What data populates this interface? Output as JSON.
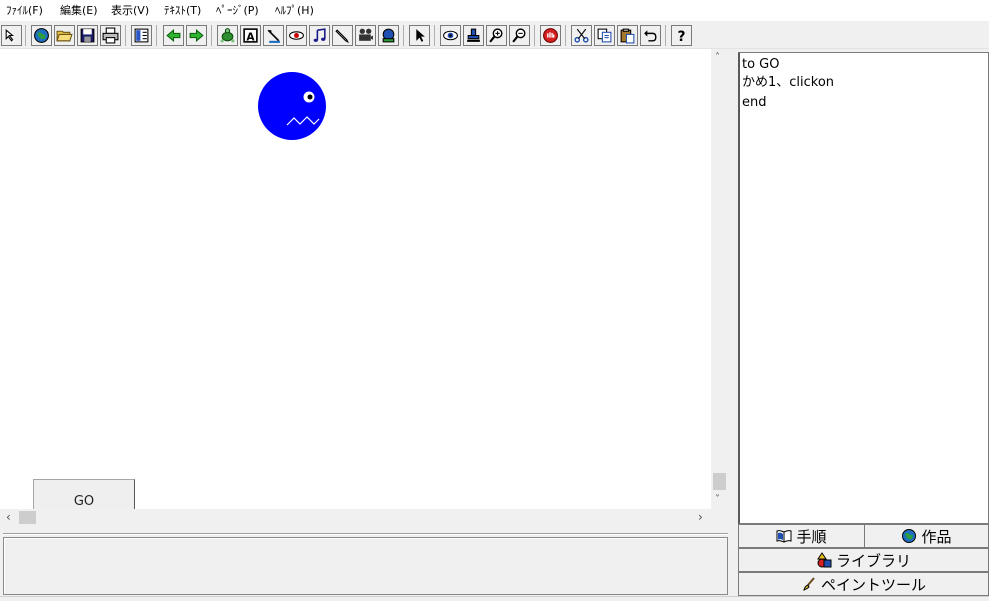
{
  "menu": {
    "file": "ﾌｧｲﾙ(F)",
    "edit": "編集(E)",
    "view": "表示(V)",
    "text": "ﾃｷｽﾄ(T)",
    "page": "ﾍﾟｰｼﾞ(P)",
    "help": "ﾍﾙﾌﾟ(H)"
  },
  "toolbar": {
    "icons": [
      "pointer-arrow-icon",
      "globe-icon",
      "open-folder-icon",
      "save-icon",
      "print-icon",
      "layout-icon",
      "back-arrow-icon",
      "forward-arrow-icon",
      "turtle-icon",
      "text-box-icon",
      "eraser-icon",
      "eye-stamp-icon",
      "music-note-icon",
      "pencil-icon",
      "camera-icon",
      "screen-icon",
      "select-arrow-icon",
      "eye-icon",
      "stamp-icon",
      "zoom-in-icon",
      "zoom-out-icon",
      "stop-icon",
      "cut-icon",
      "copy-icon",
      "paste-icon",
      "undo-icon",
      "help-icon"
    ]
  },
  "canvas": {
    "go_button_label": "GO",
    "turtle_color": "#0000ff"
  },
  "script": {
    "lines": [
      "to GO",
      "かめ1、clickon",
      "end"
    ]
  },
  "tabs": {
    "steps": "手順",
    "works": "作品",
    "library": "ライブラリ",
    "paint": "ペイントツール"
  }
}
